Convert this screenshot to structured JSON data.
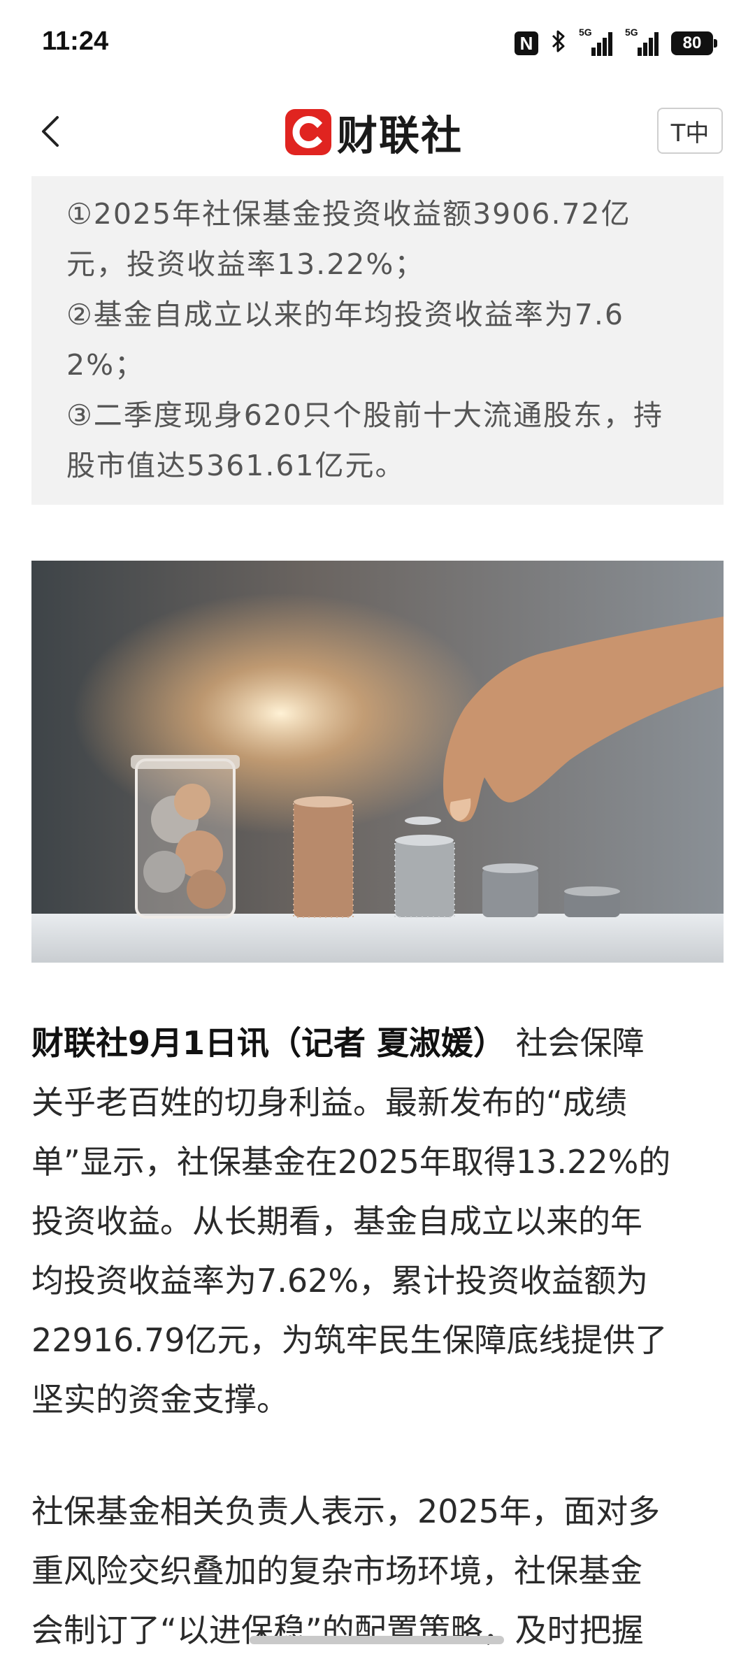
{
  "status_bar": {
    "time": "11:24",
    "nfc": "N",
    "signal1_label": "5G",
    "signal2_label": "5G",
    "battery": "80"
  },
  "header": {
    "logo_text": "财联社",
    "font_size_button": "T中"
  },
  "summary": {
    "lines": [
      "①2025年社保基金投资收益额3906.72亿",
      "元，投资收益率13.22%；",
      "②基金自成立以来的年均投资收益率为7.6",
      "2%；",
      "③二季度现身620只个股前十大流通股东，持",
      "股市值达5361.61亿元。"
    ]
  },
  "article": {
    "para1": {
      "lead": "财联社9月1日讯（记者 夏淑媛）",
      "line1_rest": " 社会保障",
      "lines": [
        "关乎老百姓的切身利益。最新发布的“成绩",
        "单”显示，社保基金在2025年取得13.22%的",
        "投资收益。从长期看，基金自成立以来的年",
        "均投资收益率为7.62%，累计投资收益额为",
        "22916.79亿元，为筑牢民生保障底线提供了",
        "坚实的资金支撑。"
      ]
    },
    "para2": {
      "lines": [
        "社保基金相关负责人表示，2025年，面对多",
        "重风险交织叠加的复杂市场环境，社保基金",
        "会制订了“以进保稳”的配置策略，及时把握"
      ]
    }
  },
  "colors": {
    "brand_red": "#e02420",
    "summary_bg": "#f2f2f2"
  }
}
